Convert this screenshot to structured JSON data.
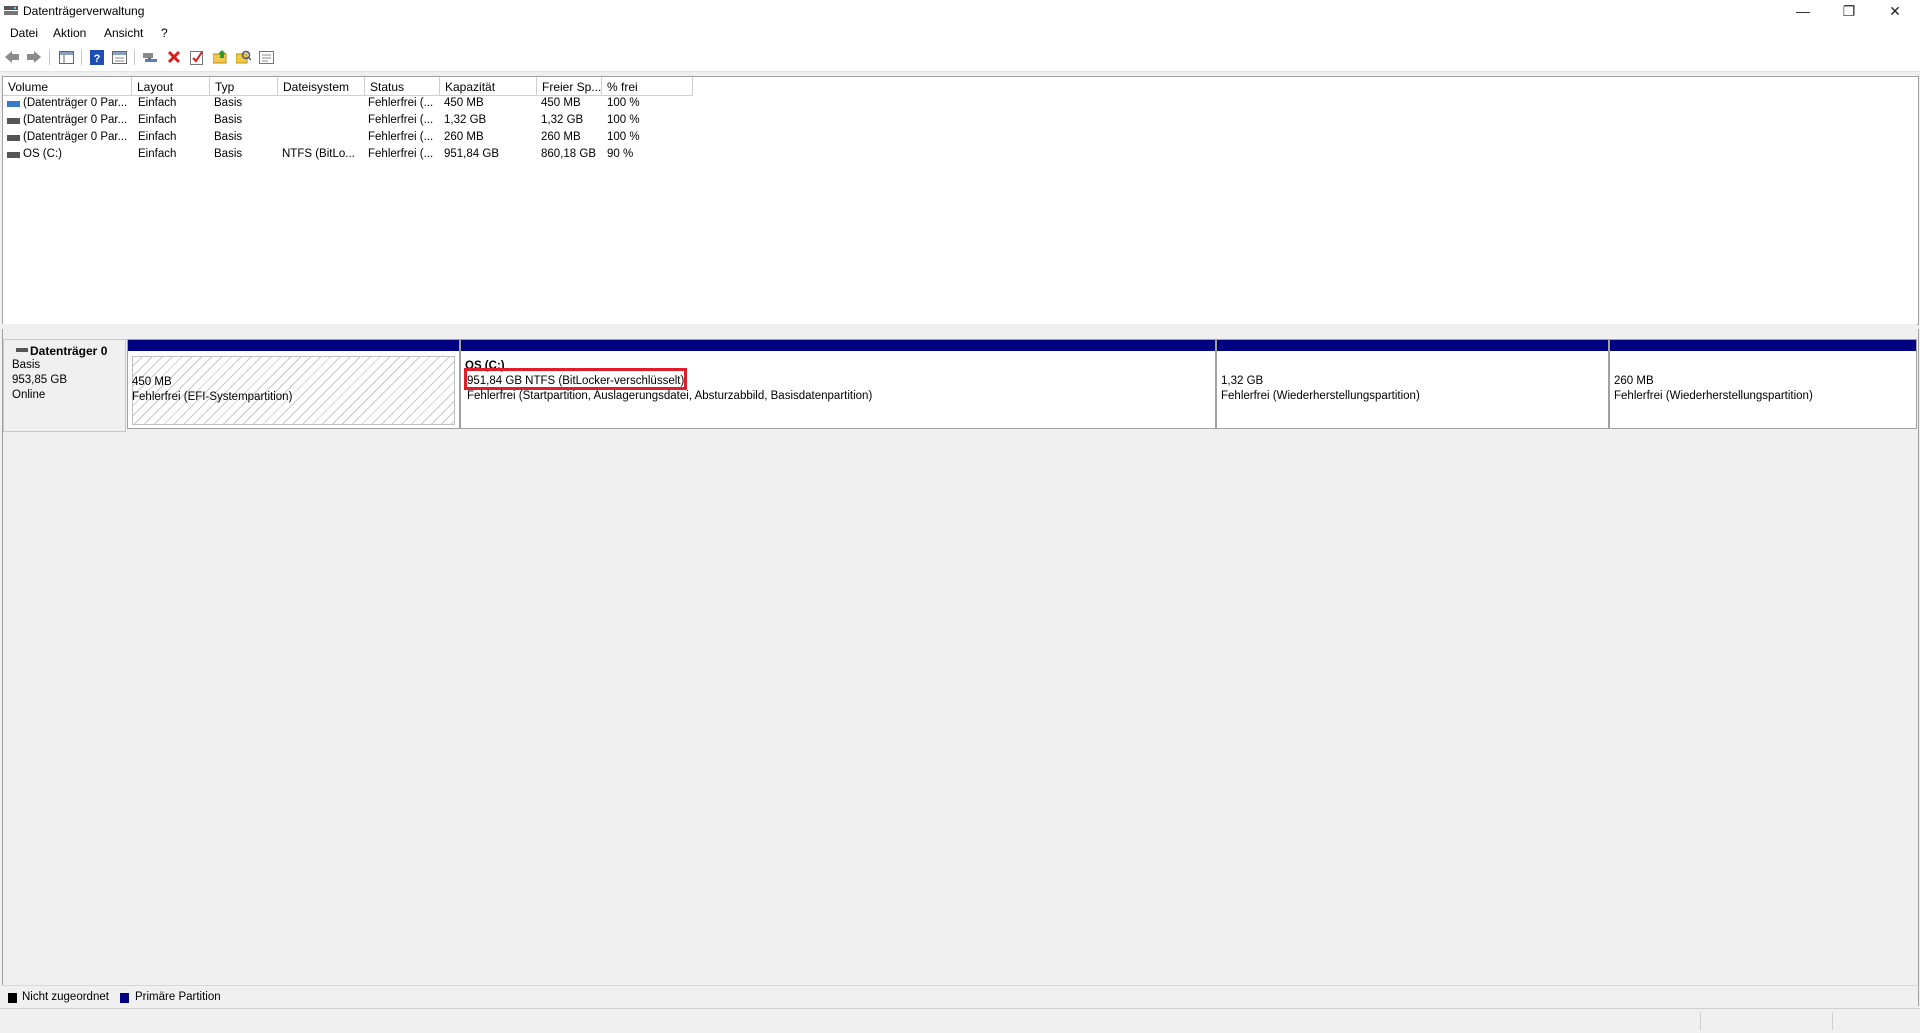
{
  "window": {
    "title": "Datenträgerverwaltung",
    "minimize_glyph": "—",
    "restore_glyph": "❐",
    "close_glyph": "✕"
  },
  "menu": [
    "Datei",
    "Aktion",
    "Ansicht",
    "?"
  ],
  "toolbar_icons": [
    "back-icon",
    "forward-icon",
    "console-tree-icon",
    "help-icon",
    "properties-icon",
    "connect-icon",
    "delete-icon",
    "check-icon",
    "new-folder-icon",
    "search-icon",
    "view-icon"
  ],
  "columns": [
    "Volume",
    "Layout",
    "Typ",
    "Dateisystem",
    "Status",
    "Kapazität",
    "Freier Sp...",
    "% frei"
  ],
  "volumes": [
    {
      "volume": "(Datenträger 0 Par...",
      "layout": "Einfach",
      "typ": "Basis",
      "dateisystem": "",
      "status": "Fehlerfrei (...",
      "kapazitaet": "450 MB",
      "frei": "450 MB",
      "prozent": "100 %"
    },
    {
      "volume": "(Datenträger 0 Par...",
      "layout": "Einfach",
      "typ": "Basis",
      "dateisystem": "",
      "status": "Fehlerfrei (...",
      "kapazitaet": "1,32 GB",
      "frei": "1,32 GB",
      "prozent": "100 %"
    },
    {
      "volume": "(Datenträger 0 Par...",
      "layout": "Einfach",
      "typ": "Basis",
      "dateisystem": "",
      "status": "Fehlerfrei (...",
      "kapazitaet": "260 MB",
      "frei": "260 MB",
      "prozent": "100 %"
    },
    {
      "volume": "OS (C:)",
      "layout": "Einfach",
      "typ": "Basis",
      "dateisystem": "NTFS (BitLo...",
      "status": "Fehlerfrei (...",
      "kapazitaet": "951,84 GB",
      "frei": "860,18 GB",
      "prozent": "90 %"
    }
  ],
  "disk": {
    "name": "Datenträger 0",
    "type": "Basis",
    "size": "953,85 GB",
    "state": "Online"
  },
  "partitions": [
    {
      "title": "",
      "line1": "450 MB",
      "line2": "Fehlerfrei (EFI-Systempartition)"
    },
    {
      "title": "OS (C:)",
      "line1": "951,84 GB NTFS (BitLocker-verschlüsselt)",
      "line2": "Fehlerfrei (Startpartition, Auslagerungsdatei, Absturzabbild, Basisdatenpartition)"
    },
    {
      "title": "",
      "line1": "1,32 GB",
      "line2": "Fehlerfrei (Wiederherstellungspartition)"
    },
    {
      "title": "",
      "line1": "260 MB",
      "line2": "Fehlerfrei (Wiederherstellungspartition)"
    }
  ],
  "legend": [
    {
      "label": "Nicht zugeordnet",
      "color": "#000000"
    },
    {
      "label": "Primäre Partition",
      "color": "#000080"
    }
  ],
  "colors": {
    "primary_partition": "#000080",
    "unallocated": "#000000",
    "highlight": "#e11d2a"
  }
}
